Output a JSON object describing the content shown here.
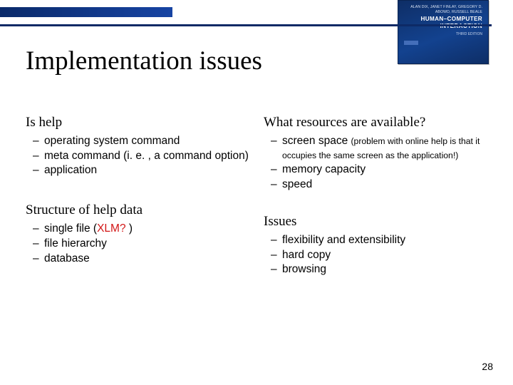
{
  "book": {
    "authors": "ALAN DIX, JANET FINLAY, GREGORY D. ABOWD, RUSSELL BEALE",
    "title": "HUMAN–COMPUTER INTERACTION",
    "edition": "THIRD EDITION"
  },
  "title": "Implementation issues",
  "left": {
    "section1": {
      "head": "Is help",
      "items": [
        "operating system command",
        "meta command (i. e. , a command option)",
        "application"
      ]
    },
    "section2": {
      "head": "Structure of help data",
      "items": [
        {
          "pre": "single file (",
          "red": "XLM? ",
          "post": ")"
        },
        "file hierarchy",
        "database"
      ]
    }
  },
  "right": {
    "section1": {
      "head": "What resources are available?",
      "items": [
        {
          "main": "screen space ",
          "paren": "(problem with online help is that it occupies the same screen as the application!)"
        },
        "memory capacity",
        "speed"
      ]
    },
    "section2": {
      "head": "Issues",
      "items": [
        "flexibility and extensibility",
        "hard copy",
        "browsing"
      ]
    }
  },
  "page": "28"
}
